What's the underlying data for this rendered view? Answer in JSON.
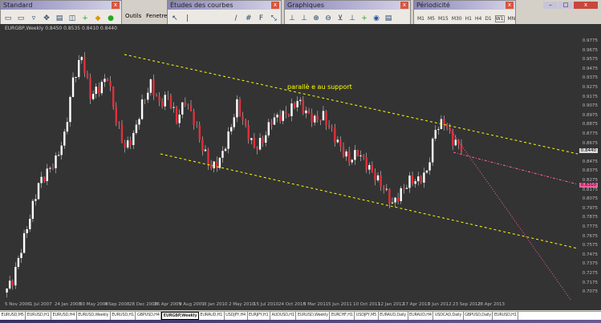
{
  "toolbars": {
    "standard": {
      "title": "Standard",
      "icons": [
        "new-chart-icon",
        "profiles-icon",
        "market-watch-icon",
        "navigator-icon",
        "terminal-icon",
        "strategy-tester-icon",
        "new-order-icon",
        "metaeditor-icon",
        "autotrading-icon"
      ]
    },
    "outils_label": "Outils",
    "fenetre_label": "Fenetre",
    "objects": {
      "title": "Études des courbes"
    },
    "charts": {
      "title": "Graphiques"
    },
    "periods": {
      "title": "Périodicité",
      "items": [
        "M1",
        "M5",
        "M15",
        "M30",
        "H1",
        "H4",
        "D1",
        "W1",
        "MN"
      ],
      "active": "W1"
    }
  },
  "chart": {
    "header": "EURGBP,Weekly  0.8450 0.8535 0.8410 0.8440",
    "annotation": "parallè e au support",
    "colors": {
      "background": "#333333",
      "bull": "#ffffff",
      "bear": "#e0303a",
      "support_line": "#ffff00",
      "pink_line": "#ff5fa0"
    },
    "price_labels": [
      "0.9775",
      "0.9675",
      "0.9575",
      "0.9475",
      "0.9375",
      "0.9275",
      "0.9175",
      "0.9075",
      "0.8975",
      "0.8875",
      "0.8775",
      "0.8675",
      "0.8575",
      "0.8475",
      "0.8375",
      "0.8275",
      "0.8175",
      "0.8075",
      "0.7975",
      "0.7875",
      "0.7775",
      "0.7675",
      "0.7575",
      "0.7475",
      "0.7375",
      "0.7275",
      "0.7175",
      "0.7075"
    ],
    "current_price": "0.8440",
    "pink_price": "0.8310",
    "date_labels": [
      "5 Nov 2006",
      "1 Jul 2007",
      "24 Jan 2008",
      "30 May 2008",
      "4 Sep 2008",
      "28 Dec 2008",
      "26 Apr 2009",
      "9 Aug 2009",
      "3 Jan 2010",
      "2 May 2010",
      "15 Jul 2010",
      "24 Oct 2010",
      "5 Mar 2011",
      "5 Jun 2011",
      "10 Oct 2011",
      "12 Jan 2012",
      "17 Apr 2012",
      "5 Jun 2012",
      "23 Sep 2012",
      "28 Apr 2013"
    ],
    "closes": [
      0.6696,
      0.684,
      0.722,
      0.76,
      0.799,
      0.813,
      0.827,
      0.856,
      0.923,
      0.951,
      0.904,
      0.913,
      0.927,
      0.875,
      0.842,
      0.856,
      0.894,
      0.918,
      0.894,
      0.904,
      0.875,
      0.899,
      0.875,
      0.842,
      0.818,
      0.827,
      0.856,
      0.894,
      0.865,
      0.842,
      0.851,
      0.875,
      0.88,
      0.884,
      0.899,
      0.884,
      0.875,
      0.88,
      0.861,
      0.842,
      0.827,
      0.837,
      0.822,
      0.808,
      0.794,
      0.775,
      0.789,
      0.803,
      0.803,
      0.813,
      0.865,
      0.873,
      0.851,
      0.842
    ]
  },
  "tabs": [
    "EURUSD,M5",
    "EURUSD,H1",
    "EURUSD,H4",
    "EURUSD,Weekly",
    "EURUSD,H1",
    "GBPUSD,H4",
    "EURGBP,Weekly",
    "EURAUD,H1",
    "USDJPY,H4",
    "EURJPY,H1",
    "AUDUSD,H1",
    "EURUSD,Weekly",
    "EURCHF,H1",
    "USDJPY,M5",
    "EURAUD,Daily",
    "EURAUD,H4",
    "USDCAD,Daily",
    "GBPUSD,Daily",
    "EURUSD,H1"
  ],
  "active_tab": 6
}
